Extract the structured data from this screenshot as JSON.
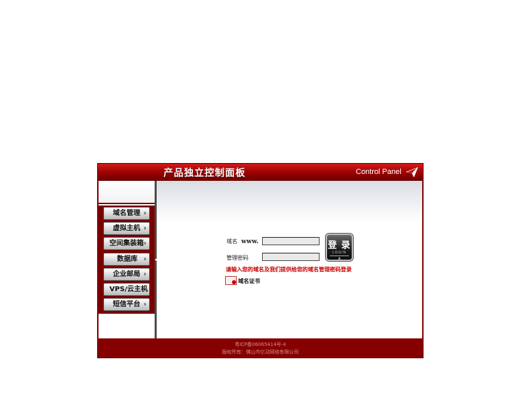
{
  "header": {
    "title": "产品独立控制面板",
    "subtitle": "Control Panel",
    "logo_icon": "red-arrow-logo"
  },
  "sidebar": {
    "items": [
      {
        "label": "域名管理",
        "arrow": "›"
      },
      {
        "label": "虚拟主机",
        "arrow": "›"
      },
      {
        "label": "空间集装箱",
        "arrow": "›"
      },
      {
        "label": "数据库",
        "arrow": "›"
      },
      {
        "label": "企业邮局",
        "arrow": "›"
      },
      {
        "label": "VPS/云主机",
        "arrow": "›"
      },
      {
        "label": "短信平台",
        "arrow": "›"
      }
    ]
  },
  "login_form": {
    "domain_label": "域名",
    "domain_prefix": "www.",
    "domain_value": "",
    "password_label": "管理密码",
    "password_value": "",
    "login_button": {
      "label": "登 录",
      "sublabel": "LOGIN",
      "symbol": "▲"
    },
    "notice": "请输入您的域名及我们提供给您的域名管理密码登录",
    "cert_link": "域名证书"
  },
  "footer": {
    "icp": "粤ICP备06065414号-4",
    "copyright": "版权所有：佛山市亿动网络有限公司"
  },
  "colors": {
    "brand_red": "#8a0000",
    "header_red": "#d21b1b",
    "notice_red": "#cc0000"
  }
}
